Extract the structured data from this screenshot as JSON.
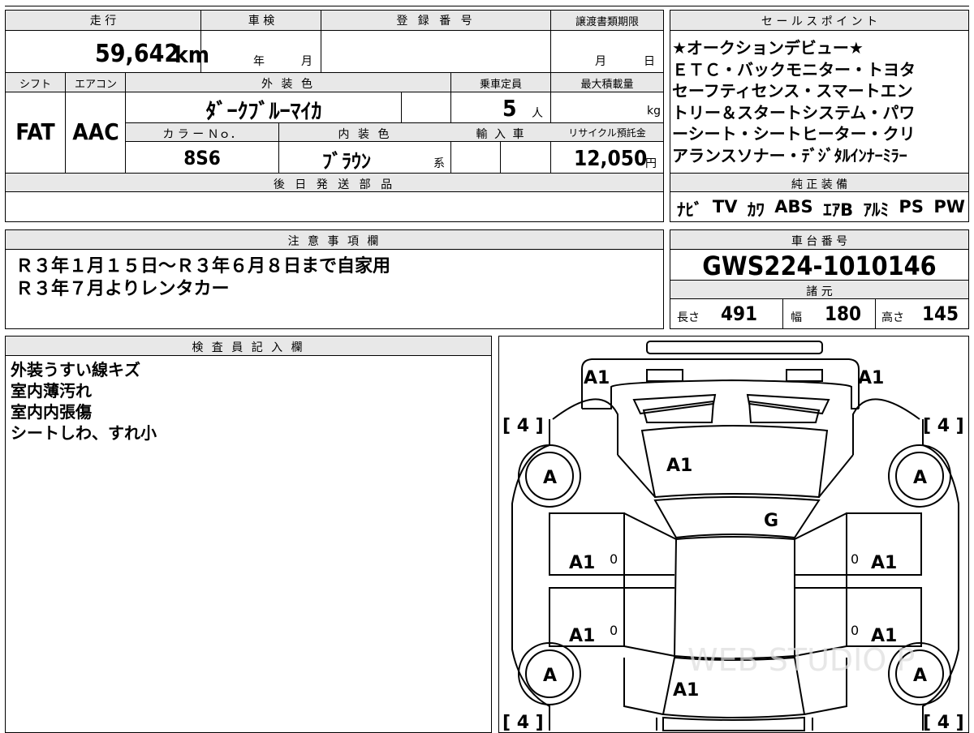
{
  "vehicle": {
    "mileage_label": "走 行",
    "mileage_value": "59,642",
    "mileage_unit": "km",
    "inspection_label": "車 検",
    "inspection_year": "年",
    "inspection_month": "月",
    "registration_label": "登 録 番 号",
    "transfer_label": "譲渡書類期限",
    "transfer_month": "月",
    "transfer_day": "日",
    "shift_label": "シフト",
    "shift_value": "FAT",
    "aircon_label": "エアコン",
    "aircon_value": "AAC",
    "exterior_color_label": "外 装 色",
    "exterior_color_value": "ﾀﾞｰｸﾌﾞﾙｰﾏｲｶ",
    "capacity_label": "乗車定員",
    "capacity_value": "5",
    "capacity_unit": "人",
    "max_load_label": "最大積載量",
    "max_load_unit": "kg",
    "color_no_label": "カ ラ ー Ｎｏ．",
    "color_no_value": "8S6",
    "interior_color_label": "内 装 色",
    "interior_color_value": "ﾌﾞﾗｳﾝ",
    "interior_color_suffix": "系",
    "import_label": "輸 入 車",
    "recycle_label": "リサイクル預託金",
    "recycle_value": "12,050",
    "recycle_unit": "円",
    "later_parts_label": "後 日 発 送 部 品"
  },
  "sales_points": {
    "label": "セ ー ル ス ポ イ ン ト",
    "lines": [
      "★オークションデビュー★",
      "ＥＴＣ・バックモニター・トヨタ",
      "セーフティセンス・スマートエン",
      "トリー＆スタートシステム・パワ",
      "ーシート・シートヒーター・クリ",
      "アランスソナー・ﾃﾞｼﾞﾀﾙｲﾝﾅｰﾐﾗｰ"
    ]
  },
  "equipment": {
    "label": "純 正 装 備",
    "items": [
      "ﾅﾋﾞ",
      "TV",
      "ｶﾜ",
      "ABS",
      "ｴｱB",
      "ｱﾙﾐ",
      "PS",
      "PW"
    ]
  },
  "notes": {
    "label": "注 意 事 項 欄",
    "lines": [
      "Ｒ３年１月１５日～Ｒ３年６月８日まで自家用",
      "Ｒ３年７月よりレンタカー"
    ]
  },
  "chassis": {
    "label": "車 台 番 号",
    "value": "GWS224-1010146",
    "specs_label": "諸 元",
    "length_label": "長さ",
    "length_value": "491",
    "width_label": "幅",
    "width_value": "180",
    "height_label": "高さ",
    "height_value": "145"
  },
  "inspector": {
    "label": "検 査 員 記 入 欄",
    "lines": [
      "外装うすい線キズ",
      "室内薄汚れ",
      "室内内張傷",
      "シートしわ、すれ小"
    ]
  },
  "diagram": {
    "front_left": "A1",
    "front_right": "A1",
    "hood": "A1",
    "windshield": "G",
    "front_door_left": "A1",
    "front_door_right": "A1",
    "rear_door_left": "A1",
    "rear_door_right": "A1",
    "trunk": "A1",
    "wheel_fl": "A",
    "wheel_fr": "A",
    "wheel_rl": "A",
    "wheel_rr": "A",
    "tire_fl": "[ 4 ]",
    "tire_fr": "[ 4 ]",
    "tire_rl": "[ 4 ]",
    "tire_rr": "[ 4 ]",
    "door_mark": "0",
    "watermark": "WEB STUDIO P"
  }
}
